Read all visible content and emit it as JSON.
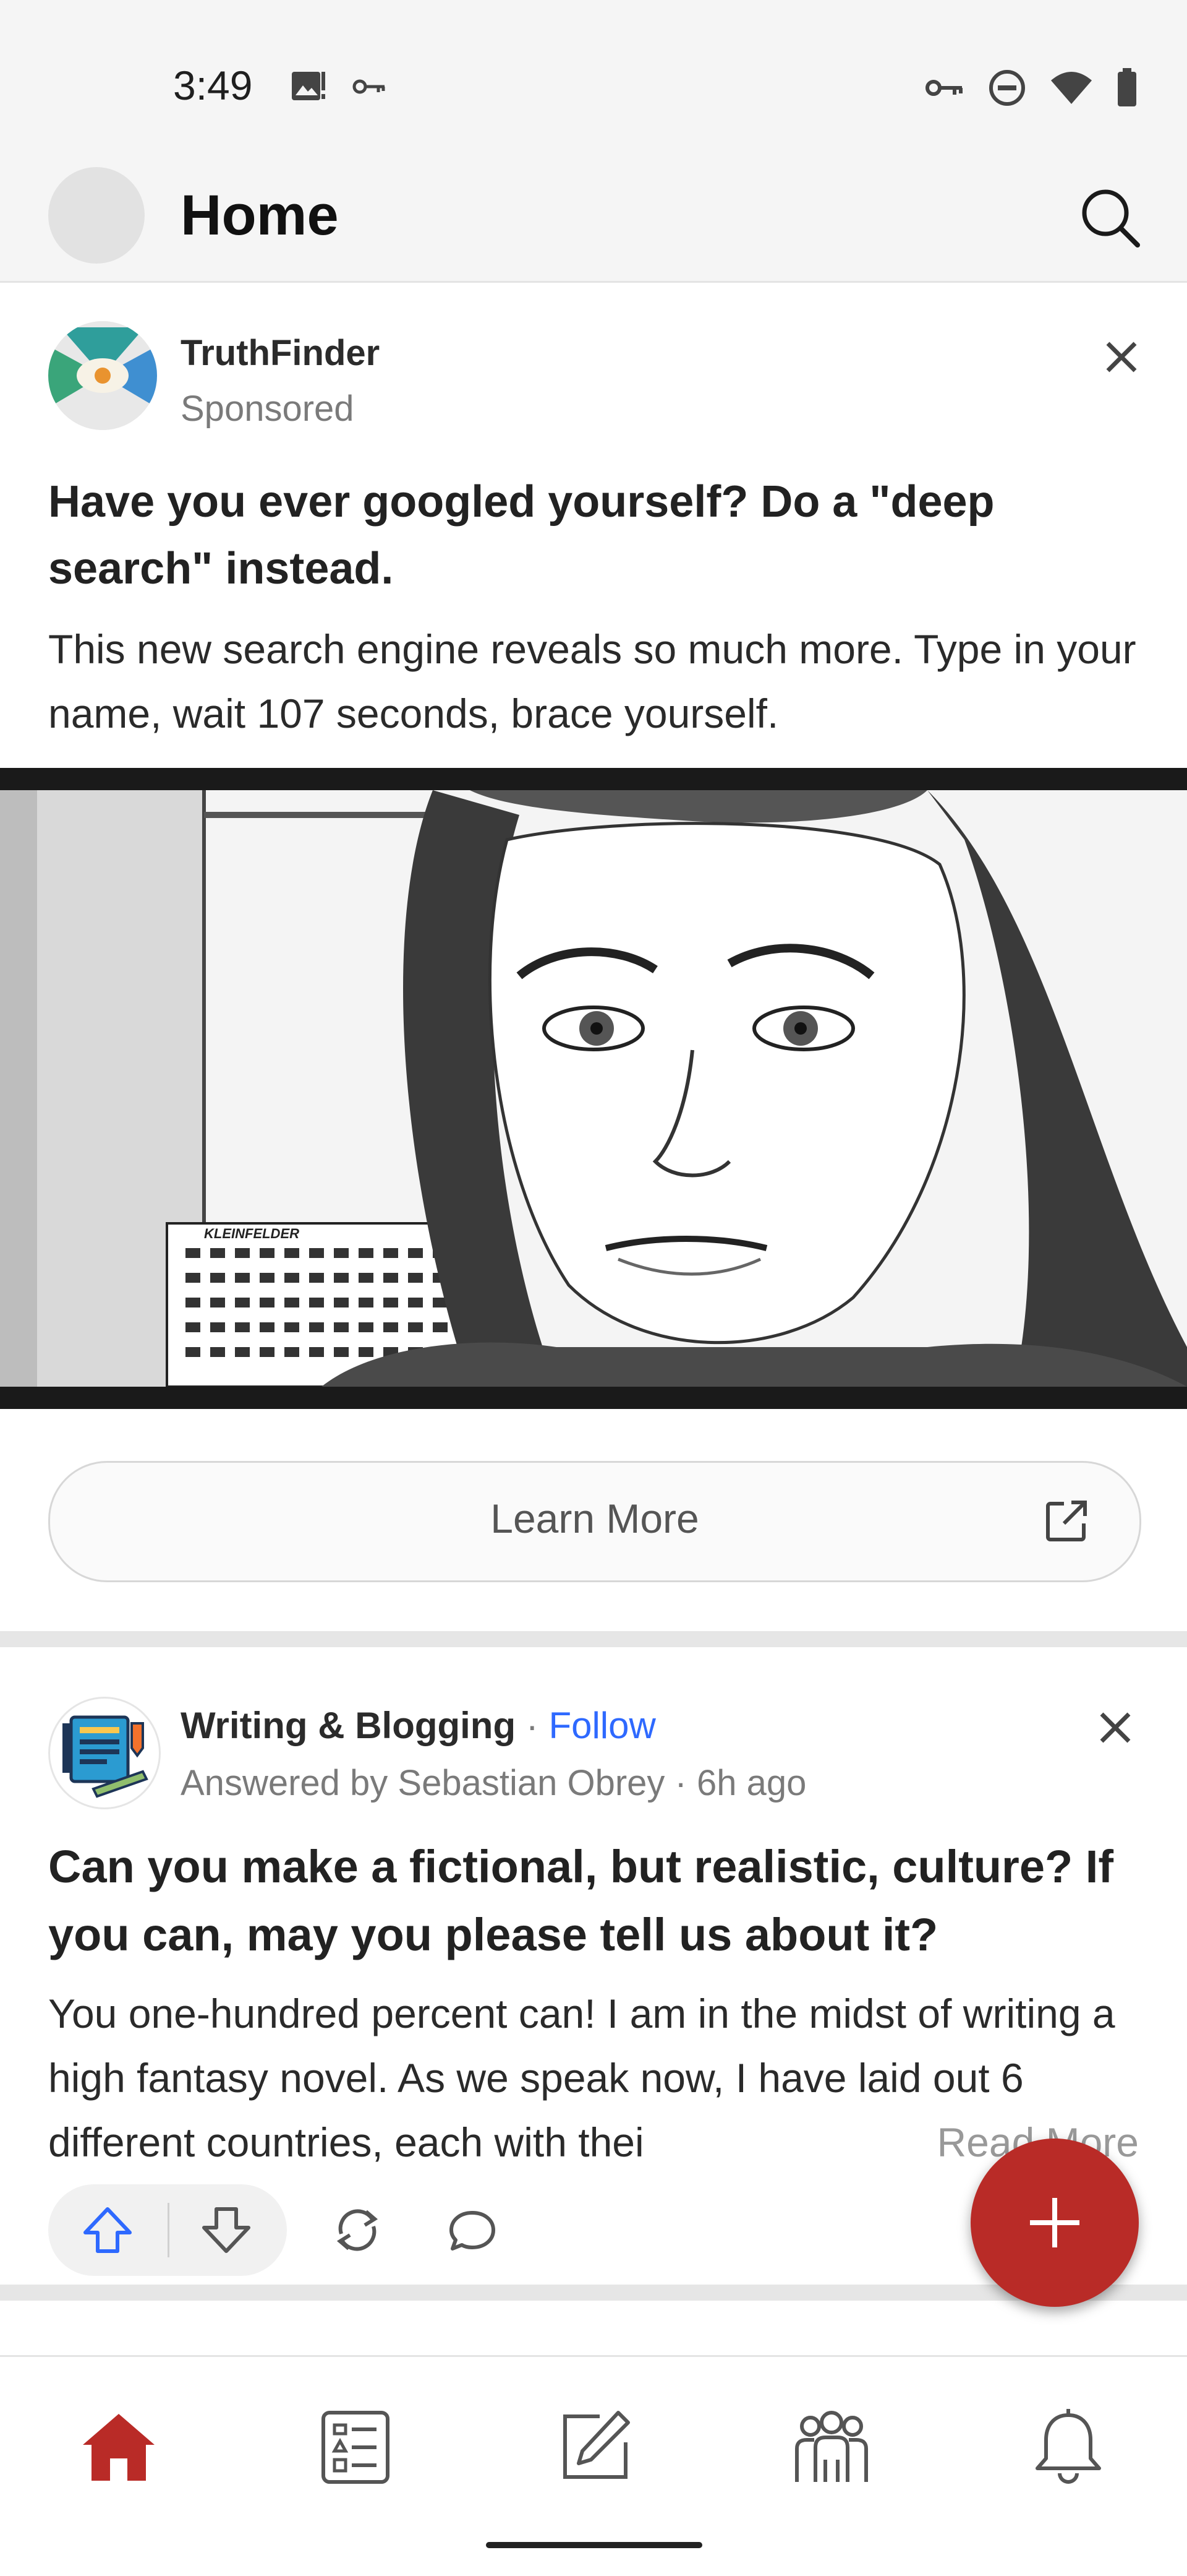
{
  "status_bar": {
    "time": "3:49",
    "left_icons": [
      "image-alert-icon",
      "key-icon"
    ],
    "right_icons": [
      "vpn-key-icon",
      "do-not-disturb-icon",
      "wifi-icon",
      "battery-icon"
    ]
  },
  "header": {
    "title": "Home",
    "search_icon": "search-icon"
  },
  "ad": {
    "advertiser": "TruthFinder",
    "sponsored_label": "Sponsored",
    "headline": "Have you ever googled yourself? Do a \"deep search\" instead.",
    "body": "This new search engine reveals so much more. Type in your name, wait 107 seconds, brace yourself.",
    "image_sign_text": "KLEINFELDER",
    "cta_label": "Learn More",
    "cta_icon": "external-link-icon"
  },
  "question_card": {
    "space_name": "Writing & Blogging",
    "separator": " · ",
    "follow_label": "Follow",
    "answered_by": "Answered by Sebastian Obrey",
    "time_ago": " · 6h ago",
    "question": "Can you make a fictional, but realistic, culture? If you can, may you please tell us about it?",
    "answer_preview": "You one-hundred percent can! I am in the midst of writing a high fantasy novel. As we speak now, I have laid out 6 different countries, each with thei",
    "read_more_label": "Read More",
    "actions": [
      "upvote-icon",
      "downvote-icon",
      "share-icon",
      "comment-icon"
    ]
  },
  "fab": {
    "icon": "plus-icon"
  },
  "bottom_nav": {
    "items": [
      "home-icon",
      "following-icon",
      "write-icon",
      "spaces-icon",
      "notifications-icon"
    ],
    "accent_color": "#b92b27"
  },
  "colors": {
    "brand_red": "#b92b27",
    "link_blue": "#2e69ff",
    "upvote_blue": "#2e69ff"
  }
}
